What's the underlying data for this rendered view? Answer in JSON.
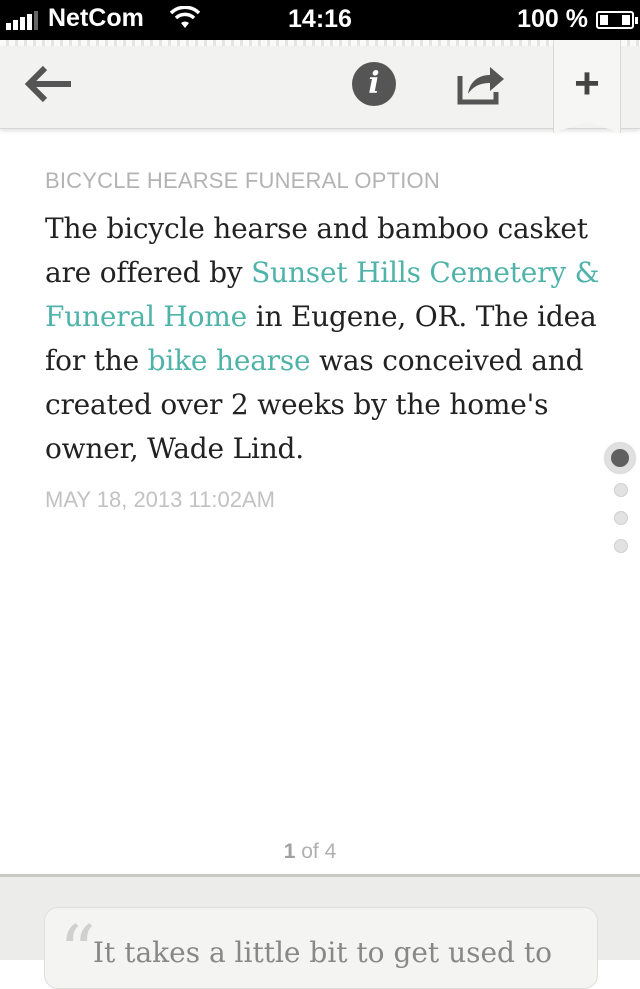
{
  "status_bar": {
    "carrier": "NetCom",
    "time": "14:16",
    "battery": "100 %"
  },
  "toolbar": {
    "back_icon": "arrow-left-icon",
    "info_icon": "info-icon",
    "share_icon": "share-icon",
    "add_icon": "plus-icon"
  },
  "article": {
    "category": "BICYCLE HEARSE FUNERAL OPTION",
    "text_1": "The bicycle hearse and bamboo casket are offered by ",
    "link_1": "Sunset Hills Cemetery & Funeral Home",
    "text_2": " in Eugene, OR. The idea for the ",
    "link_2": "bike hearse",
    "text_3": " was conceived and created over 2 weeks by the home's owner, Wade Lind.",
    "timestamp": "MAY 18, 2013 11:02AM"
  },
  "pager": {
    "current": "1",
    "of_label": "of",
    "total": "4"
  },
  "next_card": {
    "quote_mark": "“",
    "text": "It takes a little bit to get used to"
  },
  "colors": {
    "link": "#4fb3aa",
    "category": "#b3b3b3",
    "body": "#222222"
  }
}
